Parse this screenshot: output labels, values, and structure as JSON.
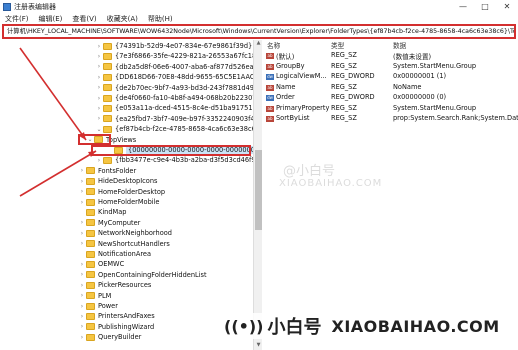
{
  "window": {
    "title": "注册表编辑器",
    "buttons": [
      "—",
      "□",
      "✕"
    ]
  },
  "menubar": [
    "文件(F)",
    "编辑(E)",
    "查看(V)",
    "收藏夹(A)",
    "帮助(H)"
  ],
  "address": "计算机\\HKEY_LOCAL_MACHINE\\SOFTWARE\\WOW6432Node\\Microsoft\\Windows\\CurrentVersion\\Explorer\\FolderTypes\\{ef87b4cb-f2ce-4785-8658-4ca6c63e38c6}\\TopVi",
  "tree": {
    "items": [
      {
        "label": "{74391b-52d9-4e07-834e-67e9861f39d}",
        "expander": "›"
      },
      {
        "label": "{7e3f6866-35fe-4229-821a-26553a67fc18}",
        "expander": "›"
      },
      {
        "label": "{db2a5d8f-06e6-4007-aba6-af877d526ea6}",
        "expander": "›"
      },
      {
        "label": "{DD618D66-70E8-48dd-9655-65C5E1AAC2D1}",
        "expander": "›"
      },
      {
        "label": "{de2b70ec-9bf7-4a93-bd3d-243f7881d492}",
        "expander": "›"
      },
      {
        "label": "{de4f0660-fa10-4b8f-a494-068b20b22307}",
        "expander": "›"
      },
      {
        "label": "{e053a11a-dced-4515-8c4e-d51ba917517b}",
        "expander": "›"
      },
      {
        "label": "{ea25fbd7-3bf7-409e-b97f-3352240903f4}",
        "expander": "›"
      },
      {
        "label": "{ef87b4cb-f2ce-4785-8658-4ca6c63e38c6}",
        "expander": "⌄"
      },
      {
        "label": "TopViews",
        "expander": "⌄"
      },
      {
        "label": "{00000000-0000-0000-0000-000000000000}",
        "expander": ""
      },
      {
        "label": "{fbb3477e-c9e4-4b3b-a2ba-d3f5d3cd46f9}",
        "expander": "›"
      },
      {
        "label": "FontsFolder",
        "expander": "›"
      },
      {
        "label": "HideDesktopIcons",
        "expander": "›"
      },
      {
        "label": "HomeFolderDesktop",
        "expander": "›"
      },
      {
        "label": "HomeFolderMobile",
        "expander": "›"
      },
      {
        "label": "KindMap",
        "expander": ""
      },
      {
        "label": "MyComputer",
        "expander": "›"
      },
      {
        "label": "NetworkNeighborhood",
        "expander": "›"
      },
      {
        "label": "NewShortcutHandlers",
        "expander": "›"
      },
      {
        "label": "NotificationArea",
        "expander": ""
      },
      {
        "label": "OEMWC",
        "expander": "›"
      },
      {
        "label": "OpenContainingFolderHiddenList",
        "expander": "›"
      },
      {
        "label": "PickerResources",
        "expander": "›"
      },
      {
        "label": "PLM",
        "expander": "›"
      },
      {
        "label": "Power",
        "expander": "›"
      },
      {
        "label": "PrintersAndFaxes",
        "expander": "›"
      },
      {
        "label": "PublishingWizard",
        "expander": "›"
      },
      {
        "label": "QueryBuilder",
        "expander": "›"
      }
    ]
  },
  "values": {
    "headers": {
      "name": "名称",
      "type": "类型",
      "data": "数据"
    },
    "rows": [
      {
        "icon": "ab",
        "name": "(默认)",
        "type": "REG_SZ",
        "data": "(数值未设置)"
      },
      {
        "icon": "ab",
        "name": "GroupBy",
        "type": "REG_SZ",
        "data": "System.StartMenu.Group"
      },
      {
        "icon": "dw",
        "name": "LogicalViewM...",
        "type": "REG_DWORD",
        "data": "0x00000001 (1)"
      },
      {
        "icon": "ab",
        "name": "Name",
        "type": "REG_SZ",
        "data": "NoName"
      },
      {
        "icon": "dw",
        "name": "Order",
        "type": "REG_DWORD",
        "data": "0x00000000 (0)"
      },
      {
        "icon": "ab",
        "name": "PrimaryProperty",
        "type": "REG_SZ",
        "data": "System.StartMenu.Group"
      },
      {
        "icon": "ab",
        "name": "SortByList",
        "type": "REG_SZ",
        "data": "prop:System.Search.Rank;System.Date"
      }
    ]
  },
  "watermark": {
    "mid_cn": "@小白号",
    "mid_en": "XIAOBAIHAO.COM",
    "logo": "((•))",
    "cn": "小白号",
    "en": "XIAOBAIHAO.COM"
  },
  "colors": {
    "highlight": "#d32f2f",
    "folder": "#f5c542",
    "selection": "#cce4f7"
  }
}
